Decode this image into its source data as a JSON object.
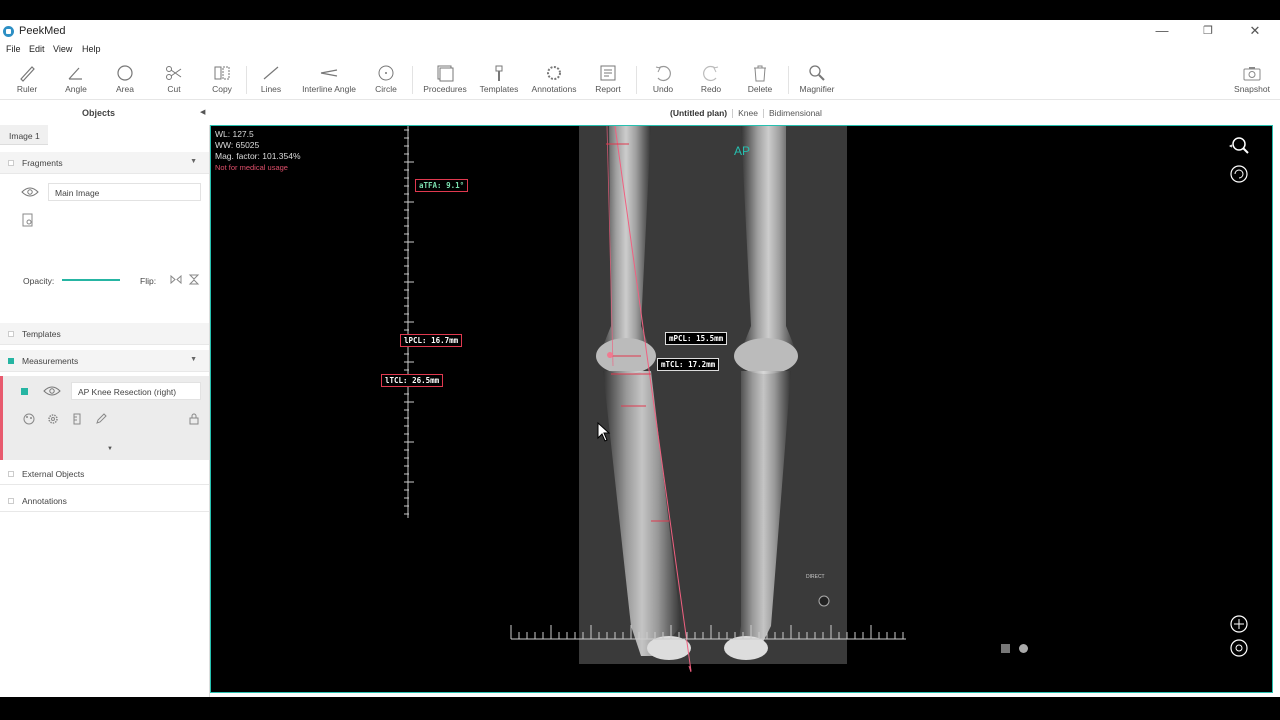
{
  "window": {
    "title": "PeekMed"
  },
  "menu": [
    "File",
    "Edit",
    "View",
    "Help"
  ],
  "toolbar": {
    "ruler": "Ruler",
    "angle": "Angle",
    "area": "Area",
    "cut": "Cut",
    "copy": "Copy",
    "lines": "Lines",
    "interline_angle": "Interline Angle",
    "circle": "Circle",
    "procedures": "Procedures",
    "templates": "Templates",
    "annotations": "Annotations",
    "report": "Report",
    "undo": "Undo",
    "redo": "Redo",
    "delete": "Delete",
    "magnifier": "Magnifier",
    "snapshot": "Snapshot"
  },
  "objects_panel": {
    "title": "Objects"
  },
  "plan": {
    "name": "(Untitled plan)",
    "anatomy": "Knee",
    "mode": "Bidimensional"
  },
  "sidebar": {
    "image_tab": "Image 1",
    "fragments": {
      "title": "Fragments",
      "main_image": "Main Image",
      "opacity_label": "Opacity:",
      "flip_label": "Flip:",
      "opacity": 1.0
    },
    "templates": {
      "title": "Templates"
    },
    "measurements": {
      "title": "Measurements",
      "item": "AP Knee Resection (right)"
    },
    "external_objects": {
      "title": "External Objects"
    },
    "annotations": {
      "title": "Annotations"
    }
  },
  "viewer": {
    "wl": "WL: 127.5",
    "ww": "WW: 65025",
    "mag": "Mag. factor: 101.354%",
    "warning": "Not for medical usage",
    "view_label": "AP",
    "direct_label": "DIRECT",
    "measurements": {
      "atfa": "aTFA: 9.1°",
      "lpcl": "lPCL: 16.7mm",
      "ltcl": "lTCL: 26.5mm",
      "mpcl": "mPCL: 15.5mm",
      "mtcl": "mTCL: 17.2mm"
    },
    "accent": "#26c0b0",
    "measure_color": "#e0394f"
  }
}
